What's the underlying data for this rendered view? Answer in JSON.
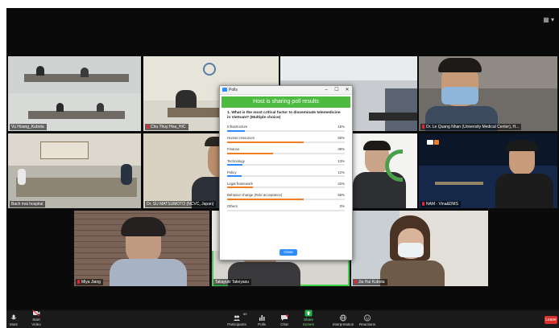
{
  "participants": [
    {
      "name": "Vu Hoang_Kubota"
    },
    {
      "name": "Chu Thuy Hoa_HIC"
    },
    {
      "name": "Dr. Le Quang Nhan (University Medical Center), H..."
    },
    {
      "name": "Bach mai hospital"
    },
    {
      "name": "Dr. SU MATSUMOTO (NCVC, Japan)"
    },
    {
      "name": "NAM - Vina&DMS"
    },
    {
      "name": "Miya Jiang"
    },
    {
      "name": "Takayuki Takeyasu"
    },
    {
      "name": "Jia Hui Kubota"
    }
  ],
  "poll": {
    "window_title": "Polls",
    "header": "Host is sharing poll results",
    "question": "1. What is the most critical factor to disseminate telemedicine in Vietnam? (Multiple choice)",
    "options": [
      {
        "label": "Infrastructure",
        "percent_text": "15%",
        "value": 15
      },
      {
        "label": "Human resources",
        "percent_text": "65%",
        "value": 65
      },
      {
        "label": "Finance",
        "percent_text": "39%",
        "value": 39
      },
      {
        "label": "Technology",
        "percent_text": "13%",
        "value": 13
      },
      {
        "label": "Policy",
        "percent_text": "12%",
        "value": 12
      },
      {
        "label": "Legal framework",
        "percent_text": "22%",
        "value": 22
      },
      {
        "label": "Behavior change (Role acceptance)",
        "percent_text": "65%",
        "value": 65
      },
      {
        "label": "Others",
        "percent_text": "0%",
        "value": 0
      }
    ],
    "close_label": "Close",
    "bar_colors": [
      "#2d8cff",
      "#f07c1e"
    ]
  },
  "toolbar": {
    "mute": "Mute",
    "start_video": "Start Video",
    "participants": "Participants",
    "participants_count": "60",
    "polls": "Polls",
    "chat": "Chat",
    "share_screen": "Share Screen",
    "interpretation": "Interpretation",
    "reactions": "Reactions",
    "end": "Leave"
  }
}
